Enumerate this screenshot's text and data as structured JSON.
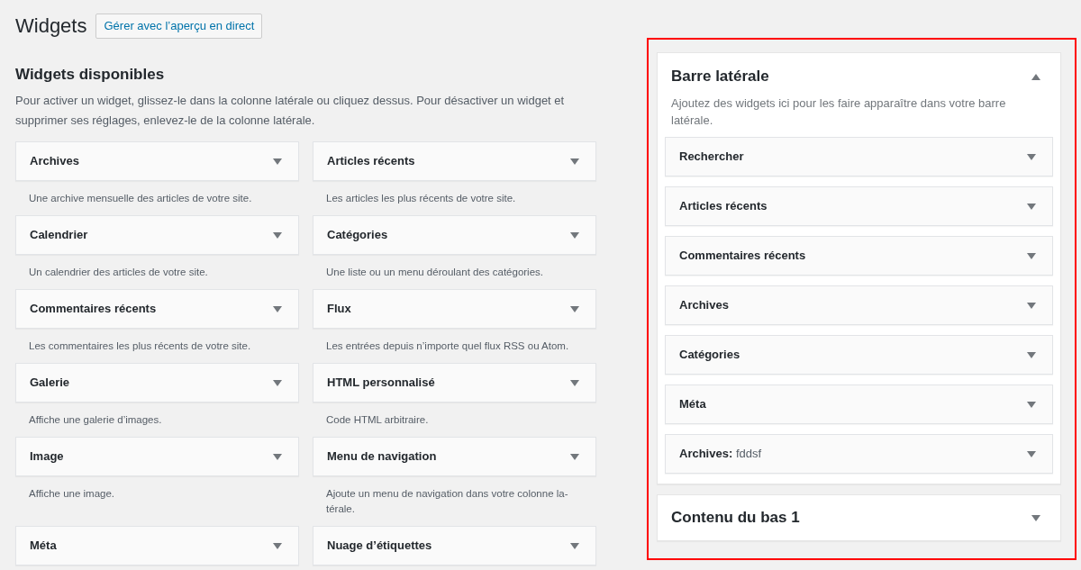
{
  "page_title": "Widgets",
  "live_preview_button": "Gérer avec l’aperçu en direct",
  "available": {
    "title": "Widgets disponibles",
    "description": "Pour activer un widget, glissez-le dans la colonne latérale ou cliquez dessus. Pour désactiver un widget et supprimer ses réglages, enlevez-le de la colonne latérale.",
    "widgets": [
      {
        "name": "Archives",
        "description": "Une archive mensuelle des articles de votre site."
      },
      {
        "name": "Articles récents",
        "description": "Les articles les plus récents de votre site."
      },
      {
        "name": "Calendrier",
        "description": "Un calendrier des articles de votre site."
      },
      {
        "name": "Catégories",
        "description": "Une liste ou un menu déroulant des catégories."
      },
      {
        "name": "Commentaires récents",
        "description": "Les commentaires les plus récents de votre site."
      },
      {
        "name": "Flux",
        "description": "Les entrées depuis n’importe quel flux RSS ou Atom."
      },
      {
        "name": "Galerie",
        "description": "Affiche une galerie d’images."
      },
      {
        "name": "HTML personnalisé",
        "description": "Code HTML arbitraire."
      },
      {
        "name": "Image",
        "description": "Affiche une image."
      },
      {
        "name": "Menu de navigation",
        "description": "Ajoute un menu de navigation dans votre colonne la-térale."
      },
      {
        "name": "Méta"
      },
      {
        "name": "Nuage d’étiquettes"
      }
    ]
  },
  "sidebars": [
    {
      "title": "Barre latérale",
      "expanded": true,
      "description": "Ajoutez des widgets ici pour les faire apparaître dans votre barre latérale.",
      "widgets": [
        {
          "name": "Rechercher"
        },
        {
          "name": "Articles récents"
        },
        {
          "name": "Commentaires récents"
        },
        {
          "name": "Archives"
        },
        {
          "name": "Catégories"
        },
        {
          "name": "Méta"
        },
        {
          "name": "Archives:",
          "instance_title": "fddsf"
        }
      ]
    },
    {
      "title": "Contenu du bas 1",
      "expanded": false
    }
  ]
}
